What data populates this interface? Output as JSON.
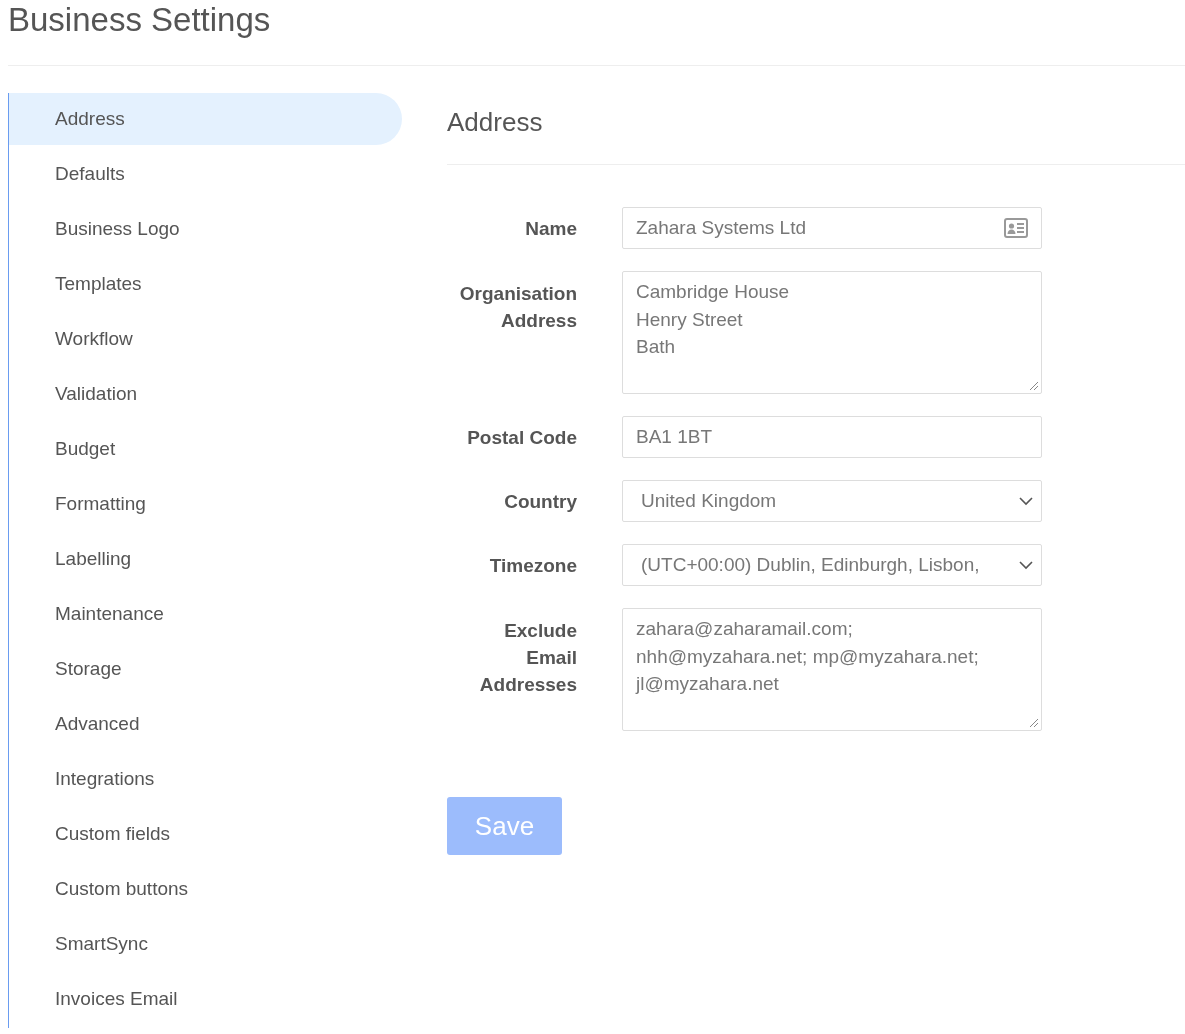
{
  "page": {
    "title": "Business Settings"
  },
  "sidebar": {
    "items": [
      {
        "label": "Address",
        "selected": true
      },
      {
        "label": "Defaults",
        "selected": false
      },
      {
        "label": "Business Logo",
        "selected": false
      },
      {
        "label": "Templates",
        "selected": false
      },
      {
        "label": "Workflow",
        "selected": false
      },
      {
        "label": "Validation",
        "selected": false
      },
      {
        "label": "Budget",
        "selected": false
      },
      {
        "label": "Formatting",
        "selected": false
      },
      {
        "label": "Labelling",
        "selected": false
      },
      {
        "label": "Maintenance",
        "selected": false
      },
      {
        "label": "Storage",
        "selected": false
      },
      {
        "label": "Advanced",
        "selected": false
      },
      {
        "label": "Integrations",
        "selected": false
      },
      {
        "label": "Custom fields",
        "selected": false
      },
      {
        "label": "Custom buttons",
        "selected": false
      },
      {
        "label": "SmartSync",
        "selected": false
      },
      {
        "label": "Invoices Email",
        "selected": false
      }
    ]
  },
  "section": {
    "title": "Address"
  },
  "form": {
    "fields": [
      {
        "kind": "text",
        "label_lines": [
          "Name"
        ],
        "value_lines": [
          "Zahara Systems Ltd"
        ],
        "icon": true
      },
      {
        "kind": "textarea",
        "label_lines": [
          "Organisation",
          "Address"
        ],
        "value_lines": [
          "Cambridge House",
          "Henry Street",
          "Bath"
        ]
      },
      {
        "kind": "text",
        "label_lines": [
          "Postal Code"
        ],
        "value_lines": [
          "BA1 1BT"
        ],
        "icon": false
      },
      {
        "kind": "select",
        "label_lines": [
          "Country"
        ],
        "value_lines": [
          "United Kingdom"
        ]
      },
      {
        "kind": "select",
        "label_lines": [
          "Timezone"
        ],
        "value_lines": [
          "(UTC+00:00) Dublin, Edinburgh, Lisbon,"
        ]
      },
      {
        "kind": "textarea",
        "label_lines": [
          "Exclude",
          "Email",
          "Addresses"
        ],
        "value_lines": [
          "zahara@zaharamail.com;",
          "nhh@myzahara.net; mp@myzahara.net;",
          "jl@myzahara.net"
        ]
      }
    ]
  },
  "save_button": {
    "label": "Save",
    "disabled": true
  }
}
